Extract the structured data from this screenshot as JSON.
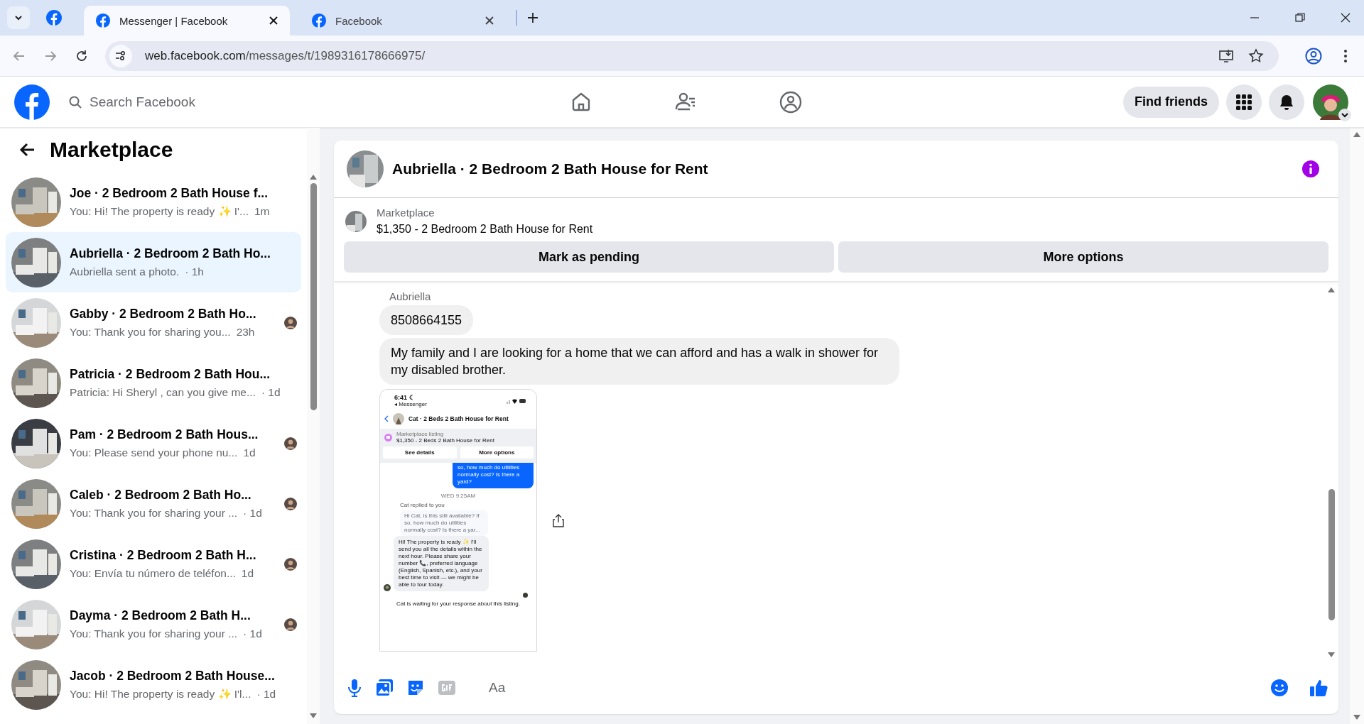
{
  "browser": {
    "tabs": [
      {
        "title": "Messenger | Facebook",
        "selected": true
      },
      {
        "title": "Facebook",
        "selected": false
      }
    ],
    "url_host": "web.facebook.com",
    "url_path": "/messages/t/1989316178666975/"
  },
  "header": {
    "search_placeholder": "Search Facebook",
    "find_friends": "Find friends"
  },
  "sidebar": {
    "title": "Marketplace",
    "conversations": [
      {
        "title": "Joe · 2 Bedroom 2 Bath House f...",
        "preview": "You: Hi! The property is ready ✨ I'...",
        "time": "1m",
        "selected": false,
        "seen": false
      },
      {
        "title": "Aubriella · 2 Bedroom 2 Bath Ho...",
        "preview": "Aubriella sent a photo.",
        "time": "· 1h",
        "selected": true,
        "seen": false
      },
      {
        "title": "Gabby · 2 Bedroom 2 Bath Ho...",
        "preview": "You: Thank you for sharing you...",
        "time": "23h",
        "selected": false,
        "seen": true
      },
      {
        "title": "Patricia · 2 Bedroom 2 Bath Hou...",
        "preview": "Patricia: Hi Sheryl , can you give me...",
        "time": "· 1d",
        "selected": false,
        "seen": false
      },
      {
        "title": "Pam · 2 Bedroom 2 Bath Hous...",
        "preview": "You: Please send your phone nu...",
        "time": "1d",
        "selected": false,
        "seen": true
      },
      {
        "title": "Caleb · 2 Bedroom 2 Bath Ho...",
        "preview": "You: Thank you for sharing your ...",
        "time": "· 1d",
        "selected": false,
        "seen": true
      },
      {
        "title": "Cristina · 2 Bedroom 2 Bath H...",
        "preview": "You: Envía tu número de teléfon...",
        "time": "1d",
        "selected": false,
        "seen": true
      },
      {
        "title": "Dayma · 2 Bedroom 2 Bath H...",
        "preview": "You: Thank you for sharing your ...",
        "time": "· 1d",
        "selected": false,
        "seen": true
      },
      {
        "title": "Jacob · 2 Bedroom 2 Bath House...",
        "preview": "You: Hi! The property is ready ✨ I'l...",
        "time": "· 1d",
        "selected": false,
        "seen": false
      }
    ]
  },
  "chat": {
    "title": "Aubriella · 2 Bedroom 2 Bath House for Rent",
    "listing_label": "Marketplace",
    "listing_title": "$1,350 - 2 Bedroom 2 Bath House for Rent",
    "actions": [
      "Mark as pending",
      "More options"
    ],
    "sender": "Aubriella",
    "messages": [
      {
        "kind": "text",
        "text": "8508664155"
      },
      {
        "kind": "text",
        "text": "My family and I are looking for a home that we can afford and has a walk in shower for my disabled brother."
      },
      {
        "kind": "screenshot",
        "time": "6:41 ☾",
        "back": "◂ Messenger",
        "title": "Cat · 2 Beds 2 Bath House for Rent",
        "listing_label": "Marketplace listing",
        "listing_title": "$1,350 - 2 Beds 2 Bath House for Rent",
        "buttons": [
          "See details",
          "More options"
        ],
        "outgoing": "so, how much do utilities normally cost? Is there a yard?",
        "timestamp": "WED 9:25AM",
        "reply_note": "Cat replied to you",
        "quoted": "Hi Cat, is this still available? If so, how much do utilities normally cost? Is there a yar...",
        "reply": "Hi! The property is ready ✨ I'll send you all the details within the next hour. Please share your number 📞, preferred language (English, Spanish, etc.), and your best time to visit — we might be able to tour today.",
        "footer": "Cat is waiting for your response about this listing."
      }
    ],
    "composer_placeholder": "Aa"
  }
}
